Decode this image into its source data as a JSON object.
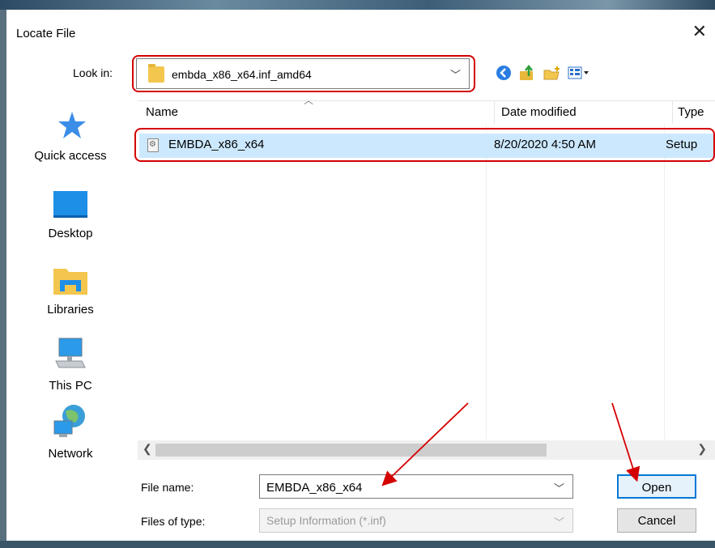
{
  "dialog": {
    "title": "Locate File"
  },
  "lookin": {
    "label": "Look in:",
    "value": "embda_x86_x64.inf_amd64"
  },
  "places": [
    {
      "label": "Quick access",
      "icon": "quick-access-icon"
    },
    {
      "label": "Desktop",
      "icon": "desktop-icon"
    },
    {
      "label": "Libraries",
      "icon": "libraries-icon"
    },
    {
      "label": "This PC",
      "icon": "this-pc-icon"
    },
    {
      "label": "Network",
      "icon": "network-icon"
    }
  ],
  "list": {
    "columns": {
      "name": "Name",
      "date": "Date modified",
      "type": "Type"
    },
    "rows": [
      {
        "name": "EMBDA_x86_x64",
        "date": "8/20/2020 4:50 AM",
        "type": "Setup"
      }
    ]
  },
  "filename": {
    "label": "File name:",
    "value": "EMBDA_x86_x64"
  },
  "filetype": {
    "label": "Files of type:",
    "value": "Setup Information (*.inf)"
  },
  "buttons": {
    "open": "Open",
    "cancel": "Cancel"
  },
  "colors": {
    "accent": "#0078d7",
    "selection": "#cce8ff",
    "annotation": "#d40000"
  }
}
